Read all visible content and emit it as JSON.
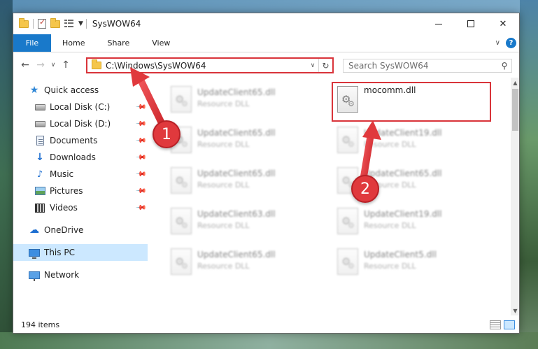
{
  "window": {
    "title": "SysWOW64",
    "controls": {
      "minimize": "minimize",
      "maximize": "maximize",
      "close": "✕"
    }
  },
  "ribbon": {
    "tabs": [
      {
        "label": "File"
      },
      {
        "label": "Home"
      },
      {
        "label": "Share"
      },
      {
        "label": "View"
      }
    ],
    "help_label": "?"
  },
  "address_bar": {
    "path": "C:\\Windows\\SysWOW64",
    "search_placeholder": "Search SysWOW64"
  },
  "sidebar": {
    "items": [
      {
        "label": "Quick access",
        "icon": "star-icon"
      },
      {
        "label": "Local Disk (C:)",
        "icon": "disk-icon",
        "pinned": true
      },
      {
        "label": "Local Disk (D:)",
        "icon": "disk-icon",
        "pinned": true
      },
      {
        "label": "Documents",
        "icon": "document-icon",
        "pinned": true
      },
      {
        "label": "Downloads",
        "icon": "download-icon",
        "pinned": true
      },
      {
        "label": "Music",
        "icon": "music-icon",
        "pinned": true
      },
      {
        "label": "Pictures",
        "icon": "pictures-icon",
        "pinned": true
      },
      {
        "label": "Videos",
        "icon": "videos-icon",
        "pinned": true
      },
      {
        "label": "OneDrive",
        "icon": "cloud-icon"
      },
      {
        "label": "This PC",
        "icon": "computer-icon",
        "selected": true
      },
      {
        "label": "Network",
        "icon": "network-icon"
      }
    ]
  },
  "files": {
    "highlighted": {
      "name": "mocomm.dll"
    },
    "left_column": [
      {
        "name": "UpdateClient65.dll",
        "type": "Resource DLL"
      },
      {
        "name": "UpdateClient65.dll",
        "type": "Resource DLL"
      },
      {
        "name": "UpdateClient65.dll",
        "type": "Resource DLL"
      },
      {
        "name": "UpdateClient63.dll",
        "type": "Resource DLL"
      },
      {
        "name": "UpdateClient65.dll",
        "type": "Resource DLL"
      }
    ],
    "right_column": [
      {
        "name": "UpdateClient19.dll",
        "type": "Resource DLL"
      },
      {
        "name": "UpdateClient65.dll",
        "type": "Resource DLL"
      },
      {
        "name": "UpdateClient19.dll",
        "type": "Resource DLL"
      },
      {
        "name": "UpdateClient5.dll",
        "type": "Resource DLL"
      }
    ]
  },
  "status": {
    "item_count": "194 items"
  },
  "annotations": [
    {
      "label": "1"
    },
    {
      "label": "2"
    }
  ],
  "colors": {
    "accent": "#1979ca",
    "annotation_red": "#e0393d",
    "selection": "#cce8ff"
  }
}
